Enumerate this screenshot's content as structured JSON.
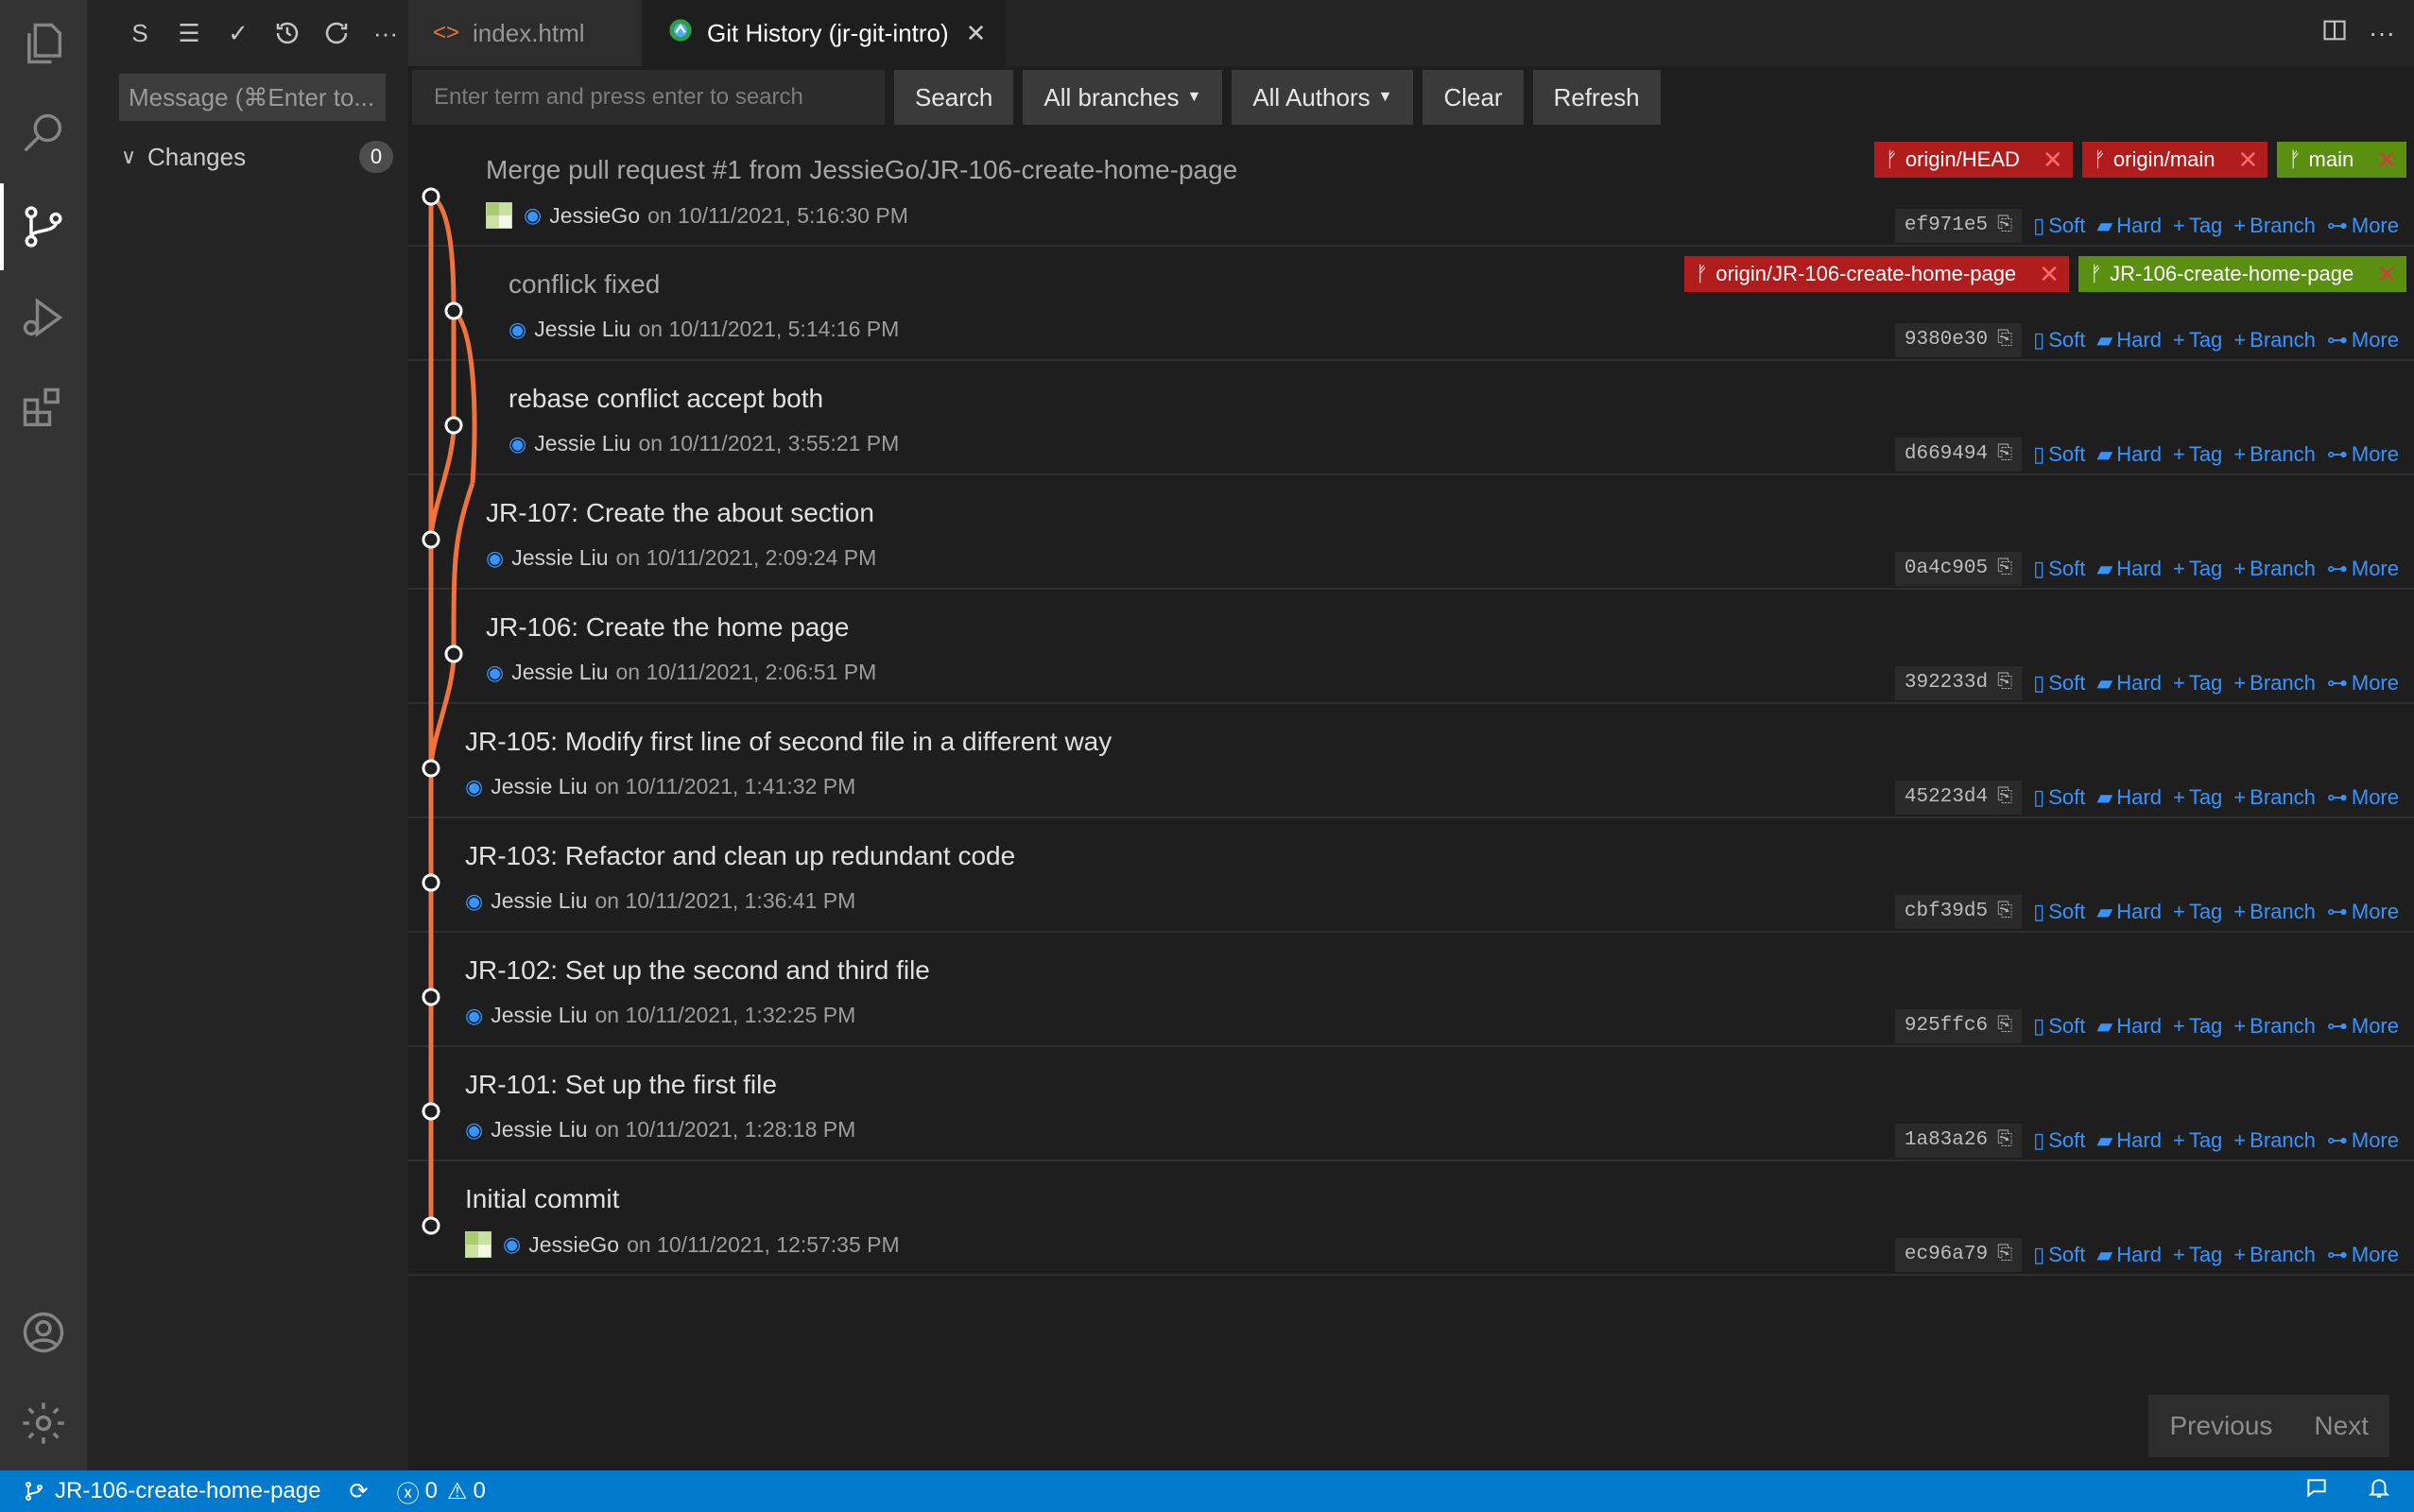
{
  "colors": {
    "accent": "#007acc",
    "link": "#3794ff",
    "graph_line": "#f0723c",
    "ref_remote": "#b11c1c",
    "ref_local": "#5a8f12"
  },
  "sidebar": {
    "toolbar": [
      "S",
      "☰",
      "✓",
      "history-icon",
      "refresh-icon",
      "···"
    ],
    "message_placeholder": "Message (⌘Enter to...",
    "changes_label": "Changes",
    "changes_count": "0"
  },
  "tabs": [
    {
      "label": "index.html",
      "icon": "<>"
    },
    {
      "label": "Git History (jr-git-intro)",
      "close": "✕"
    }
  ],
  "toolbar": {
    "search_placeholder": "Enter term and press enter to search",
    "search_label": "Search",
    "branches_label": "All branches",
    "authors_label": "All Authors",
    "clear_label": "Clear",
    "refresh_label": "Refresh"
  },
  "action_labels": {
    "soft": "Soft",
    "hard": "Hard",
    "tag": "Tag",
    "branch": "Branch",
    "more": "More"
  },
  "commits": [
    {
      "message": "Merge pull request #1 from JessieGo/JR-106-create-home-page",
      "author": "JessieGo",
      "date": "on 10/11/2021, 5:16:30 PM",
      "hash": "ef971e5",
      "refs": [
        {
          "name": "origin/HEAD",
          "type": "remote"
        },
        {
          "name": "origin/main",
          "type": "remote"
        },
        {
          "name": "main",
          "type": "local"
        }
      ]
    },
    {
      "message": "conflick fixed",
      "author": "Jessie Liu",
      "date": "on 10/11/2021, 5:14:16 PM",
      "hash": "9380e30",
      "refs": [
        {
          "name": "origin/JR-106-create-home-page",
          "type": "remote"
        },
        {
          "name": "JR-106-create-home-page",
          "type": "local"
        }
      ]
    },
    {
      "message": "rebase conflict accept both",
      "author": "Jessie Liu",
      "date": "on 10/11/2021, 3:55:21 PM",
      "hash": "d669494",
      "refs": []
    },
    {
      "message": "JR-107: Create the about section",
      "author": "Jessie Liu",
      "date": "on 10/11/2021, 2:09:24 PM",
      "hash": "0a4c905",
      "refs": []
    },
    {
      "message": "JR-106: Create the home page",
      "author": "Jessie Liu",
      "date": "on 10/11/2021, 2:06:51 PM",
      "hash": "392233d",
      "refs": []
    },
    {
      "message": "JR-105: Modify first line of second file in a different way",
      "author": "Jessie Liu",
      "date": "on 10/11/2021, 1:41:32 PM",
      "hash": "45223d4",
      "refs": []
    },
    {
      "message": "JR-103: Refactor and clean up redundant code",
      "author": "Jessie Liu",
      "date": "on 10/11/2021, 1:36:41 PM",
      "hash": "cbf39d5",
      "refs": []
    },
    {
      "message": "JR-102: Set up the second and third file",
      "author": "Jessie Liu",
      "date": "on 10/11/2021, 1:32:25 PM",
      "hash": "925ffc6",
      "refs": []
    },
    {
      "message": "JR-101: Set up the first file",
      "author": "Jessie Liu",
      "date": "on 10/11/2021, 1:28:18 PM",
      "hash": "1a83a26",
      "refs": []
    },
    {
      "message": "Initial commit",
      "author": "JessieGo",
      "date": "on 10/11/2021, 12:57:35 PM",
      "hash": "ec96a79",
      "refs": []
    }
  ],
  "pager": {
    "previous": "Previous",
    "next": "Next"
  },
  "statusbar": {
    "branch": "JR-106-create-home-page",
    "errors": "0",
    "warnings": "0"
  }
}
